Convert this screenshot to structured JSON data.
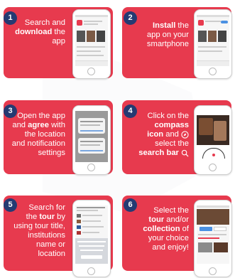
{
  "steps": [
    {
      "number": "1",
      "parts": [
        {
          "t": "Search and",
          "b": false
        },
        {
          "t": "download",
          "b": true
        },
        {
          "t": " the",
          "b": false
        },
        {
          "t": "app",
          "b": false
        }
      ]
    },
    {
      "number": "2",
      "parts": [
        {
          "t": "Install",
          "b": true
        },
        {
          "t": " the",
          "b": false
        },
        {
          "t": "app on your",
          "b": false
        },
        {
          "t": "smartphone",
          "b": false
        }
      ]
    },
    {
      "number": "3",
      "parts": [
        {
          "t": "Open the app",
          "b": false
        },
        {
          "t": "and ",
          "b": false
        },
        {
          "t": "agree",
          "b": true
        },
        {
          "t": " with",
          "b": false
        },
        {
          "t": "the location",
          "b": false
        },
        {
          "t": "and notification",
          "b": false
        },
        {
          "t": "settings",
          "b": false
        }
      ]
    },
    {
      "number": "4",
      "parts": [
        {
          "t": "Click on the",
          "b": false
        },
        {
          "t": "compass",
          "b": true
        },
        {
          "t": "icon",
          "b": true
        },
        {
          "t": " and",
          "b": false
        },
        {
          "t": "select the",
          "b": false
        },
        {
          "t": "search bar",
          "b": true
        }
      ]
    },
    {
      "number": "5",
      "parts": [
        {
          "t": "Search for",
          "b": false
        },
        {
          "t": "the ",
          "b": false
        },
        {
          "t": "tour",
          "b": true
        },
        {
          "t": " by",
          "b": false
        },
        {
          "t": "using tour title,",
          "b": false
        },
        {
          "t": "institutions",
          "b": false
        },
        {
          "t": "name or",
          "b": false
        },
        {
          "t": "location",
          "b": false
        }
      ]
    },
    {
      "number": "6",
      "parts": [
        {
          "t": "Select the",
          "b": false
        },
        {
          "t": "tour",
          "b": true
        },
        {
          "t": " and/or",
          "b": false
        },
        {
          "t": "collection",
          "b": true
        },
        {
          "t": " of",
          "b": false
        },
        {
          "t": "your choice",
          "b": false
        },
        {
          "t": "and enjoy!",
          "b": false
        }
      ]
    }
  ],
  "colors": {
    "card": "#e73a4e",
    "badge": "#253a72"
  },
  "icons": {
    "compass": "compass-icon",
    "search": "magnifier-icon"
  }
}
